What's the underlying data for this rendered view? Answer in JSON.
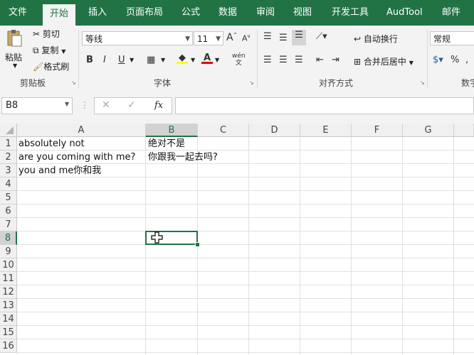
{
  "tabs": [
    "文件",
    "开始",
    "插入",
    "页面布局",
    "公式",
    "数据",
    "审阅",
    "视图",
    "开发工具",
    "AudTool",
    "邮件"
  ],
  "clipboard": {
    "paste": "粘贴",
    "cut": "剪切",
    "copy": "复制",
    "format_painter": "格式刷",
    "label": "剪贴板"
  },
  "font": {
    "name": "等线",
    "size": "11",
    "bold": "B",
    "italic": "I",
    "underline": "U",
    "grow": "A",
    "shrink": "A",
    "phonetic": "wén",
    "label": "字体"
  },
  "alignment": {
    "wrap": "自动换行",
    "merge": "合并后居中",
    "label": "对齐方式"
  },
  "number": {
    "format": "常规",
    "percent": "%",
    "label": "数字"
  },
  "formula_bar": {
    "name_box": "B8",
    "fx": "fx",
    "content": ""
  },
  "columns": [
    "A",
    "B",
    "C",
    "D",
    "E",
    "F",
    "G"
  ],
  "rows": [
    "1",
    "2",
    "3",
    "4",
    "5",
    "6",
    "7",
    "8",
    "9",
    "10",
    "11",
    "12",
    "13",
    "14",
    "15",
    "16"
  ],
  "selected": {
    "col": "B",
    "row": "8"
  },
  "cells": {
    "A1": "absolutely not",
    "B1": "绝对不是",
    "A2": "are you coming with me?",
    "B2": "你跟我一起去吗?",
    "A3": "you and me你和我"
  },
  "colors": {
    "accent": "#217346",
    "ribbon": "#f3f3f3"
  }
}
